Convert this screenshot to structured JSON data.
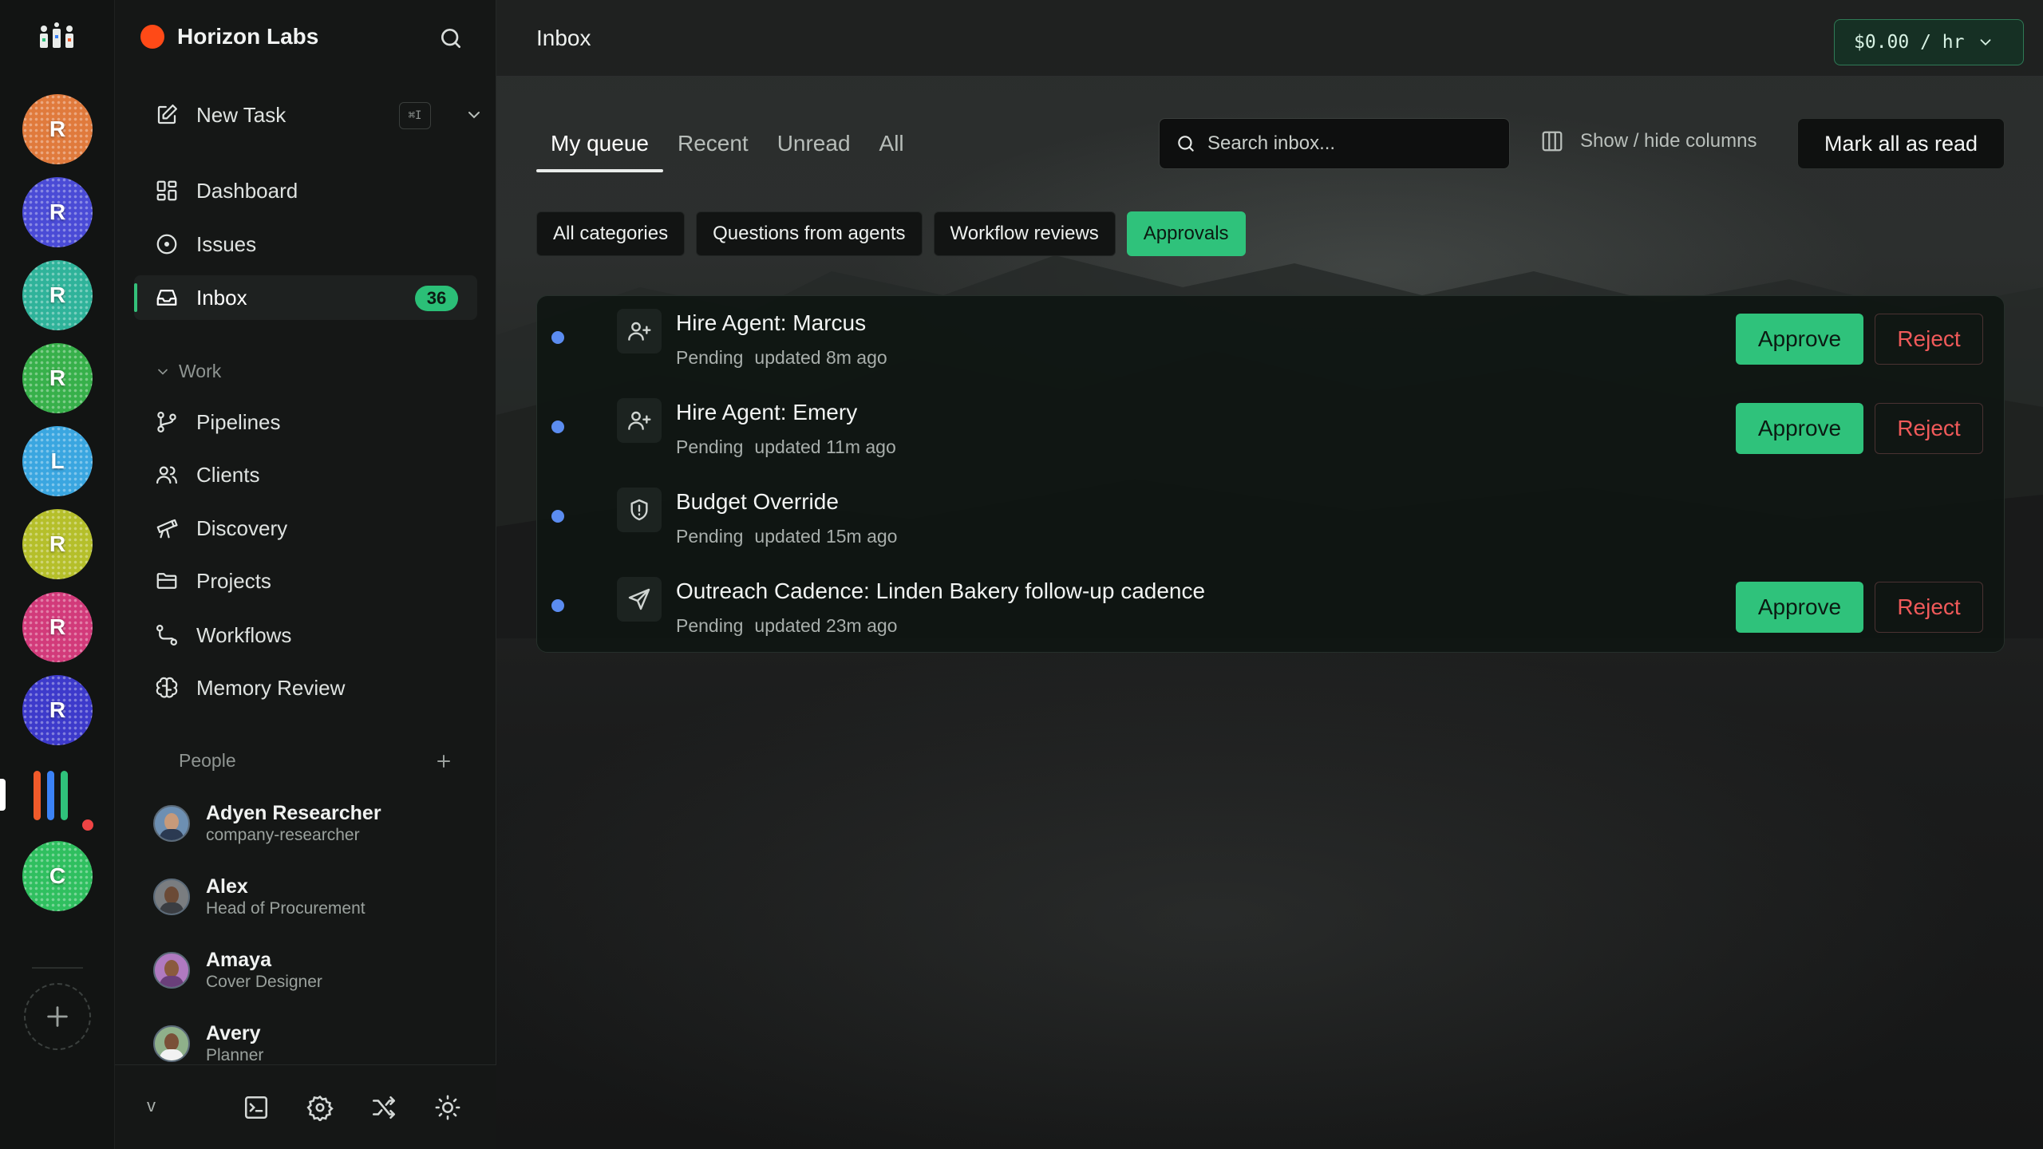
{
  "rail": {
    "workspaces": [
      {
        "initial": "R",
        "color": "#e07a3c"
      },
      {
        "initial": "R",
        "color": "#4a4bd6"
      },
      {
        "initial": "R",
        "color": "#2fb39a"
      },
      {
        "initial": "R",
        "color": "#37b04a"
      },
      {
        "initial": "L",
        "color": "#3aa6e0"
      },
      {
        "initial": "R",
        "color": "#b5bf2a"
      },
      {
        "initial": "R",
        "color": "#d23a7a"
      },
      {
        "initial": "R",
        "color": "#3d3acb"
      },
      {
        "initial": "C",
        "color": "#2fbf5f"
      }
    ],
    "app_bar_colors": [
      "#f05a2a",
      "#3b82f6",
      "#2fc27b"
    ]
  },
  "sidebar": {
    "org_name": "Horizon Labs",
    "new_task": {
      "label": "New Task",
      "shortcut": "⌘I"
    },
    "nav": [
      {
        "label": "Dashboard",
        "icon": "dashboard-icon"
      },
      {
        "label": "Issues",
        "icon": "issues-icon"
      },
      {
        "label": "Inbox",
        "icon": "inbox-icon",
        "badge": "36",
        "active": true
      }
    ],
    "work_section": "Work",
    "work_items": [
      {
        "label": "Pipelines",
        "icon": "pipelines-icon"
      },
      {
        "label": "Clients",
        "icon": "clients-icon"
      },
      {
        "label": "Discovery",
        "icon": "telescope-icon"
      },
      {
        "label": "Projects",
        "icon": "folder-icon"
      },
      {
        "label": "Workflows",
        "icon": "workflows-icon"
      },
      {
        "label": "Memory Review",
        "icon": "brain-icon"
      }
    ],
    "people_section": "People",
    "people": [
      {
        "name": "Adyen Researcher",
        "role": "company-researcher"
      },
      {
        "name": "Alex",
        "role": "Head of Procurement"
      },
      {
        "name": "Amaya",
        "role": "Cover Designer"
      },
      {
        "name": "Avery",
        "role": "Planner"
      }
    ],
    "version": "v"
  },
  "header": {
    "title": "Inbox",
    "rate": "$0.00 / hr"
  },
  "tabs": [
    {
      "label": "My queue",
      "active": true
    },
    {
      "label": "Recent"
    },
    {
      "label": "Unread"
    },
    {
      "label": "All"
    }
  ],
  "toolbar": {
    "search_placeholder": "Search inbox...",
    "columns_label": "Show / hide columns",
    "mark_all_label": "Mark all as read"
  },
  "filters": [
    {
      "label": "All categories"
    },
    {
      "label": "Questions from agents"
    },
    {
      "label": "Workflow reviews"
    },
    {
      "label": "Approvals",
      "active": true
    }
  ],
  "items": [
    {
      "title": "Hire Agent: Marcus",
      "status": "Pending",
      "updated": "updated 8m ago",
      "icon": "user-plus-icon",
      "approve": "Approve",
      "reject": "Reject"
    },
    {
      "title": "Hire Agent: Emery",
      "status": "Pending",
      "updated": "updated 11m ago",
      "icon": "user-plus-icon",
      "approve": "Approve",
      "reject": "Reject"
    },
    {
      "title": "Budget Override",
      "status": "Pending",
      "updated": "updated 15m ago",
      "icon": "shield-alert-icon"
    },
    {
      "title": "Outreach Cadence: Linden Bakery follow-up cadence",
      "status": "Pending",
      "updated": "updated 23m ago",
      "icon": "send-icon",
      "approve": "Approve",
      "reject": "Reject"
    }
  ],
  "colors": {
    "accent_green": "#2fc27b",
    "reject_red": "#f05a5a",
    "unread_dot": "#5b8cf0",
    "org_dot": "#ff4a17"
  }
}
